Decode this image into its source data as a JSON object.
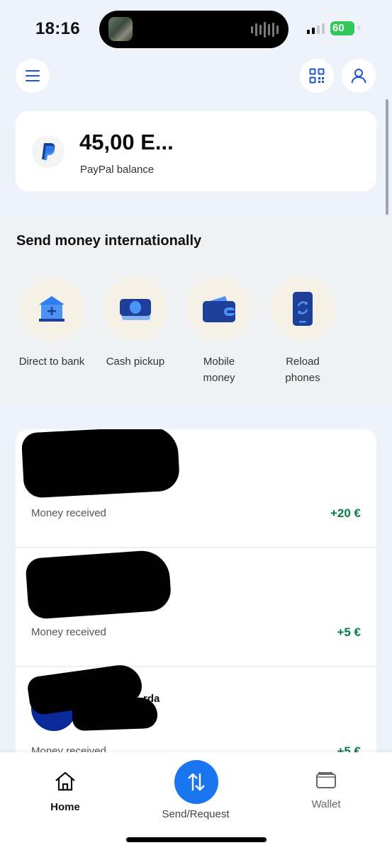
{
  "status_bar": {
    "time": "18:16",
    "battery": "60"
  },
  "balance": {
    "amount": "45,00 E...",
    "label": "PayPal balance"
  },
  "send_international": {
    "title": "Send money internationally",
    "options": [
      {
        "label": "Direct to bank",
        "icon": "bank-icon"
      },
      {
        "label": "Cash pickup",
        "icon": "cash-icon"
      },
      {
        "label": "Mobile money",
        "icon": "wallet-icon"
      },
      {
        "label": "Reload phones",
        "icon": "phone-reload-icon"
      }
    ]
  },
  "activity": [
    {
      "description": "Money received",
      "amount": "+20 €"
    },
    {
      "description": "Money received",
      "amount": "+5 €"
    },
    {
      "name_fragment": "rda",
      "description": "Money received",
      "amount": "+5 €"
    }
  ],
  "tabs": {
    "home": "Home",
    "send": "Send/Request",
    "wallet": "Wallet"
  },
  "colors": {
    "accent": "#1976f0",
    "positive": "#0b7a4b",
    "icon_dark": "#1d3f9a"
  }
}
